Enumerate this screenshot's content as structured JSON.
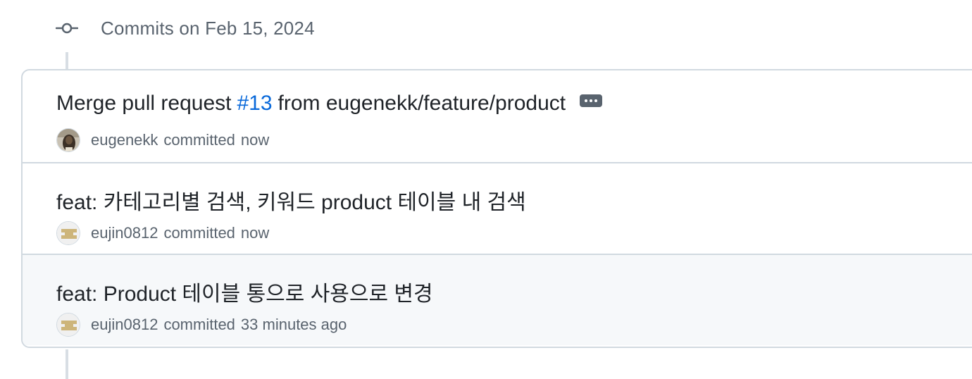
{
  "group": {
    "title": "Commits on Feb 15, 2024",
    "icon": "git-commit-icon"
  },
  "commits": [
    {
      "title_prefix": "Merge pull request",
      "pr_number": "#13",
      "title_suffix": "from eugenekk/feature/product",
      "author": "eugenekk",
      "verb": "committed",
      "time": "now",
      "avatar": "photo-avatar",
      "has_ellipsis": true
    },
    {
      "title": "feat: 카테고리별 검색, 키워드 product 테이블 내 검색",
      "author": "eujin0812",
      "verb": "committed",
      "time": "now",
      "avatar": "identicon-avatar"
    },
    {
      "title": "feat: Product 테이블 통으로 사용으로 변경",
      "author": "eujin0812",
      "verb": "committed",
      "time": "33 minutes ago",
      "avatar": "identicon-avatar",
      "highlighted": true
    }
  ],
  "colors": {
    "link": "#0969da",
    "muted": "#59636e",
    "border": "#d1d9e0",
    "highlight_bg": "#f6f8fa"
  }
}
